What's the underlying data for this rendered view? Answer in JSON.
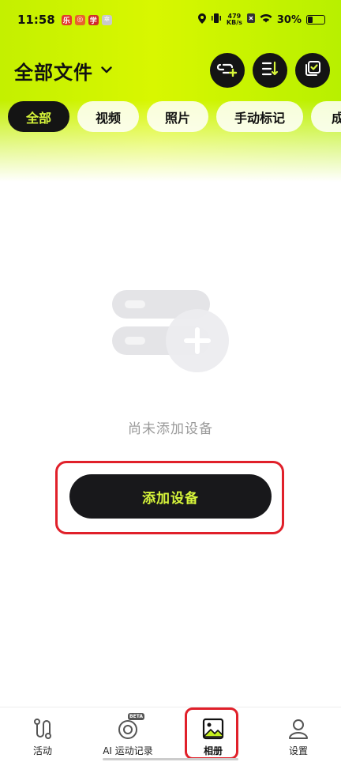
{
  "status_bar": {
    "time": "11:58",
    "net_speed_value": "479",
    "net_speed_unit": "KB/s",
    "battery": "30%"
  },
  "header": {
    "title": "全部文件"
  },
  "tabs": [
    {
      "label": "全部",
      "active": true
    },
    {
      "label": "视频",
      "active": false
    },
    {
      "label": "照片",
      "active": false
    },
    {
      "label": "手动标记",
      "active": false
    },
    {
      "label": "成",
      "active": false
    }
  ],
  "empty_state": {
    "message": "尚未添加设备",
    "button_label": "添加设备"
  },
  "bottom_nav": [
    {
      "label": "活动",
      "icon": "activity-route-icon"
    },
    {
      "label": "AI 运动记录",
      "icon": "ai-record-icon",
      "badge": "BETA"
    },
    {
      "label": "相册",
      "icon": "album-image-icon",
      "active": true
    },
    {
      "label": "设置",
      "icon": "person-settings-icon"
    }
  ],
  "colors": {
    "accent": "#d7f53a",
    "dark": "#141414",
    "highlight": "#e0202a"
  }
}
